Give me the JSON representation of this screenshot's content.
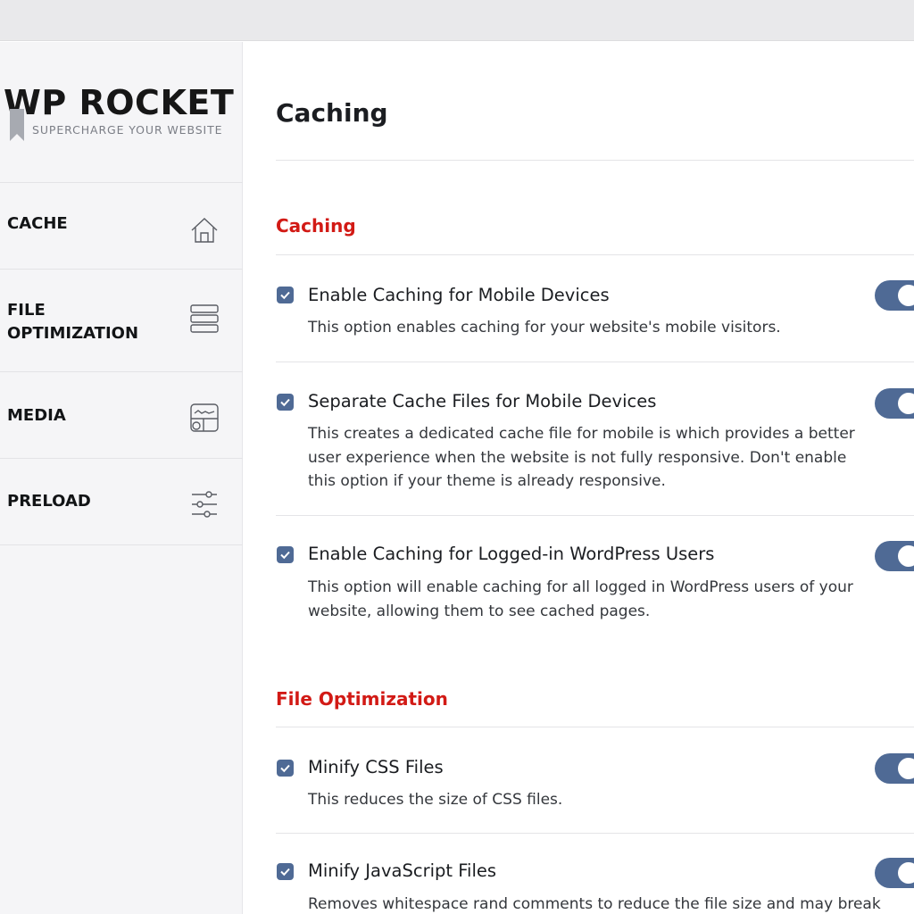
{
  "brand": {
    "title": "WP ROCKET",
    "tagline": "SUPERCHARGE YOUR WEBSITE"
  },
  "sidebar": {
    "items": [
      {
        "label": "CACHE",
        "icon": "home-icon"
      },
      {
        "label": "FILE\nOPTIMIZATION",
        "icon": "stack-icon"
      },
      {
        "label": "MEDIA",
        "icon": "media-icon"
      },
      {
        "label": "PRELOAD",
        "icon": "sliders-icon"
      }
    ]
  },
  "main": {
    "page_title": "Caching",
    "sections": [
      {
        "title": "Caching",
        "options": [
          {
            "title": "Enable Caching for Mobile Devices",
            "description": "This option enables caching for your website's mobile visitors.",
            "checked": true,
            "enabled": true
          },
          {
            "title": "Separate Cache Files for Mobile Devices",
            "description": "This creates a dedicated cache file for mobile is which provides a better user experience when the website is not fully responsive. Don't enable this option if your theme is already responsive.",
            "checked": true,
            "enabled": true
          },
          {
            "title": "Enable Caching for Logged-in WordPress Users",
            "description": "This option will enable caching for all logged in WordPress users of your website, allowing them to see cached pages.",
            "checked": true,
            "enabled": true
          }
        ]
      },
      {
        "title": "File Optimization",
        "options": [
          {
            "title": "Minify CSS Files",
            "description": "This reduces the size of CSS files.",
            "checked": true,
            "enabled": true
          },
          {
            "title": "Minify JavaScript Files",
            "description": "Removes whitespace rand comments to reduce the file size and may break",
            "checked": true,
            "enabled": true
          }
        ]
      }
    ]
  },
  "colors": {
    "accent": "#4f6a95",
    "section_title": "#d21a15",
    "sidebar_bg": "#f5f5f7",
    "topbar_bg": "#e9e9eb"
  }
}
